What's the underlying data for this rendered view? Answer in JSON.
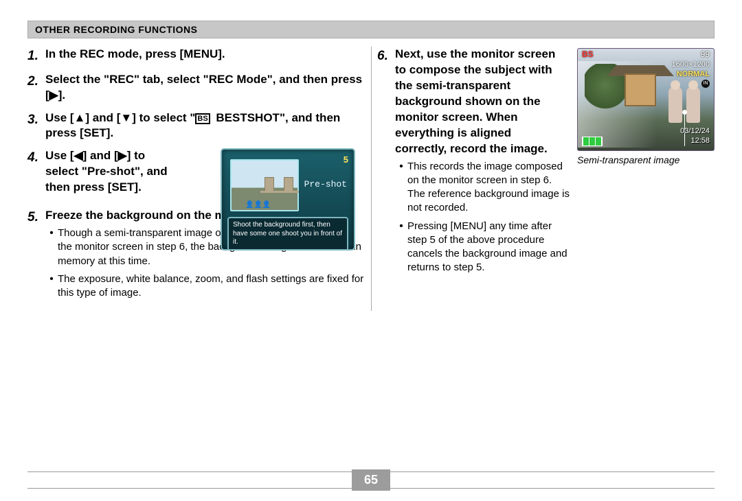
{
  "header": {
    "title": "OTHER RECORDING FUNCTIONS"
  },
  "left": {
    "step1": "In the REC mode, press [MENU].",
    "step2_a": "Select the \"REC\" tab, select \"REC Mode\", and then press [",
    "step2_b": "].",
    "step3_a": "Use [",
    "step3_b": "] and [",
    "step3_c": "] to select \"",
    "step3_d": " BESTSHOT\", and then press [SET].",
    "step4_a": "Use [",
    "step4_b": "] and [",
    "step4_c": "] to select \"Pre-shot\", and then press [SET].",
    "step5": "Freeze the background on the monitor screen.",
    "b5_1": "Though a semi-transparent image of the background appears on the monitor screen in step 6, the background image is not saved in memory at this time.",
    "b5_2": "The exposure, white balance, zoom, and flash settings are fixed for this type of image."
  },
  "lcd1": {
    "number": "5",
    "title": "Pre-shot",
    "msg": "Shoot the background first, then have some one shoot you in front of it."
  },
  "right": {
    "step6": "Next, use the monitor screen to compose the subject with the semi-transparent background shown on the monitor screen. When everything is aligned correctly, record the image.",
    "b6_1": "This records the image composed on the monitor screen in step 6. The reference background image is not recorded.",
    "b6_2": "Pressing [MENU] any time after step 5 of the above procedure cancels the background image and returns to step 5."
  },
  "lcd2": {
    "bs": "BS",
    "count": "99",
    "res": "1600×1200",
    "quality": "NORMAL",
    "mem": "IN",
    "date": "03/12/24",
    "time": "12:58",
    "caption": "Semi-transparent image"
  },
  "page": "65",
  "glyph": {
    "up": "▲",
    "down": "▼",
    "left": "◀",
    "right": "▶",
    "bs": "BS"
  }
}
